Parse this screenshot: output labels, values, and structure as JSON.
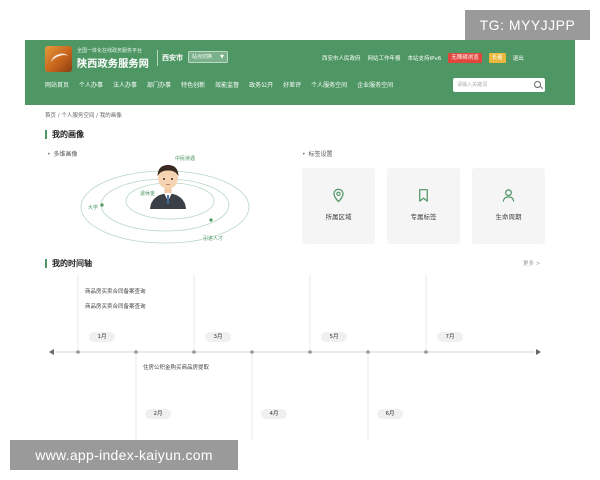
{
  "watermarks": {
    "top": "TG: MYYJJPP",
    "bottom": "www.app-index-kaiyun.com"
  },
  "header": {
    "logo_subtitle": "全国一体化在线政务服务平台",
    "logo_title": "陕西政务服务网",
    "city": "西安市",
    "city_switch": "站点切换",
    "top_links": [
      "西安市人民政府",
      "网站工作年报",
      "本站支持IPv6"
    ],
    "accessibility_badge": "无障碍浏览",
    "elder_badge": "长者",
    "logout": "退出",
    "nav": [
      "网站首页",
      "个人办事",
      "法人办事",
      "部门办事",
      "特色创新",
      "效能监督",
      "政务公开",
      "好差评",
      "个人服务空间",
      "企业服务空间"
    ],
    "search_placeholder": "请输入关键词"
  },
  "breadcrumb": "首页 / 个人服务空间 / 我的画像",
  "portrait": {
    "title": "我的画像",
    "multi_label": "多维画像",
    "settings_label": "标签设置",
    "persona_tags": [
      "中民待遇",
      "退休金",
      "大学",
      "引进人才"
    ],
    "cards": [
      {
        "icon": "location-pin-icon",
        "label": "所属区域"
      },
      {
        "icon": "bookmark-icon",
        "label": "专属标签"
      },
      {
        "icon": "person-icon",
        "label": "生命周期"
      }
    ]
  },
  "timeline": {
    "title": "我的时间轴",
    "more": "更多 >",
    "events": [
      "商品房买卖合同备案查询",
      "商品房买卖合同备案查询",
      "住房公积金购买商品房提取"
    ],
    "months_top": [
      "1月",
      "3月",
      "5月",
      "7月"
    ],
    "months_bottom": [
      "2月",
      "4月",
      "6月"
    ]
  },
  "colors": {
    "header": "#4e9663",
    "accent_red": "#e2453c",
    "accent_yellow": "#e9b83d"
  }
}
